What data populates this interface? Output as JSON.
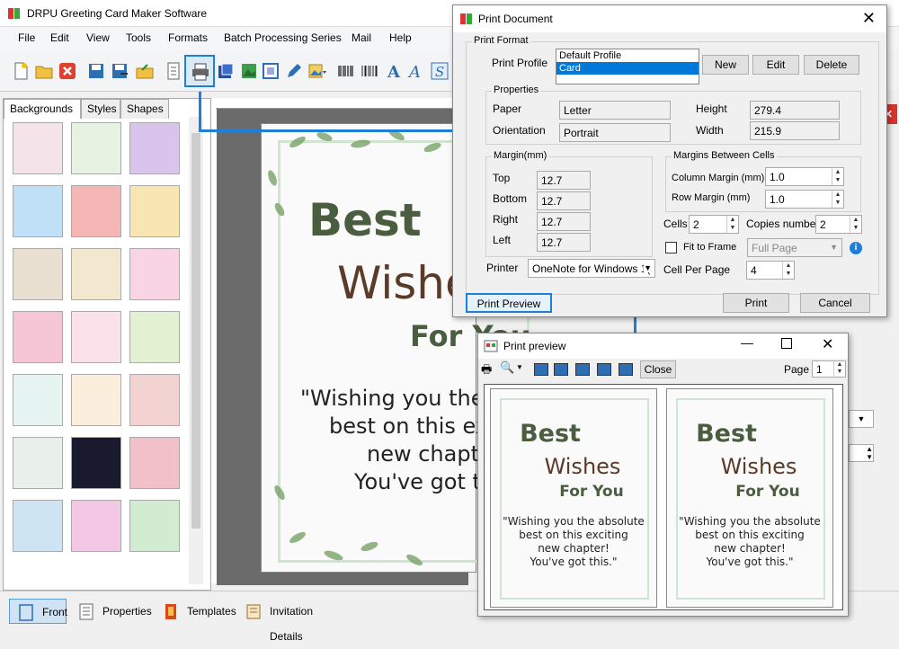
{
  "app": {
    "title": "DRPU Greeting Card Maker Software"
  },
  "menu": [
    "File",
    "Edit",
    "View",
    "Tools",
    "Formats",
    "Batch Processing Series",
    "Mail",
    "Help"
  ],
  "left_panel": {
    "tabs": [
      "Backgrounds",
      "Styles",
      "Shapes"
    ]
  },
  "card": {
    "line1": "Best",
    "line2": "Wishe",
    "line3": "For You",
    "quote": [
      "\"Wishing you the",
      "best on this exc",
      "new chapt",
      "You've got t"
    ]
  },
  "bottom_tabs": [
    "Front",
    "Properties",
    "Templates",
    "Invitation Details"
  ],
  "print_dialog": {
    "title": "Print Document",
    "print_format_label": "Print Format",
    "print_profile_label": "Print Profile",
    "profiles": [
      "Default Profile",
      "Card"
    ],
    "new_btn": "New",
    "edit_btn": "Edit",
    "delete_btn": "Delete",
    "properties_label": "Properties",
    "paper_label": "Paper",
    "paper_value": "Letter",
    "orientation_label": "Orientation",
    "orientation_value": "Portrait",
    "height_label": "Height",
    "height_value": "279.4",
    "width_label": "Width",
    "width_value": "215.9",
    "margin_label": "Margin(mm)",
    "top_label": "Top",
    "top_value": "12.7",
    "bottom_label": "Bottom",
    "bottom_value": "12.7",
    "right_label": "Right",
    "right_value": "12.7",
    "left_label": "Left",
    "left_value": "12.7",
    "margins_cells_label": "Margins Between Cells",
    "column_margin_label": "Column Margin (mm)",
    "column_margin_value": "1.0",
    "row_margin_label": "Row Margin (mm)",
    "row_margin_value": "1.0",
    "cells_label": "Cells",
    "cells_value": "2",
    "copies_label": "Copies number",
    "copies_value": "2",
    "fit_to_frame_label": "Fit to Frame",
    "full_page_value": "Full Page",
    "cell_per_page_label": "Cell Per Page",
    "cell_per_page_value": "4",
    "printer_label": "Printer",
    "printer_value": "OneNote for Windows 1(",
    "print_preview_btn": "Print Preview",
    "print_btn": "Print",
    "cancel_btn": "Cancel"
  },
  "preview": {
    "title": "Print preview",
    "close_btn": "Close",
    "page_label": "Page",
    "page_value": "1",
    "card_line1": "Best",
    "card_line2": "Wishes",
    "card_line3": "For You",
    "quote": [
      "\"Wishing you the absolute",
      "best on this exciting",
      "new chapter!",
      "You've got this.\""
    ]
  },
  "colors": {
    "accent": "#1e7fd8",
    "card_green": "#4a5d3f",
    "card_brown": "#5a3a28"
  }
}
